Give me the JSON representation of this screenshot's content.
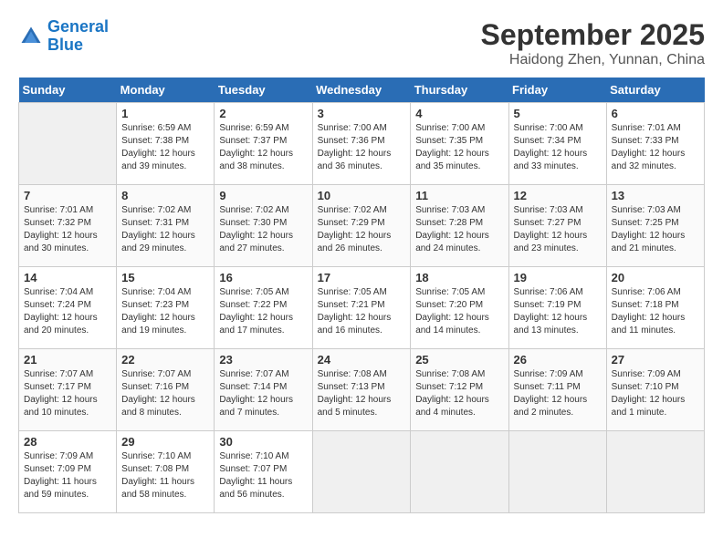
{
  "logo": {
    "line1": "General",
    "line2": "Blue"
  },
  "title": "September 2025",
  "subtitle": "Haidong Zhen, Yunnan, China",
  "weekdays": [
    "Sunday",
    "Monday",
    "Tuesday",
    "Wednesday",
    "Thursday",
    "Friday",
    "Saturday"
  ],
  "weeks": [
    [
      {
        "day": "",
        "empty": true
      },
      {
        "day": "1",
        "sunrise": "Sunrise: 6:59 AM",
        "sunset": "Sunset: 7:38 PM",
        "daylight": "Daylight: 12 hours and 39 minutes."
      },
      {
        "day": "2",
        "sunrise": "Sunrise: 6:59 AM",
        "sunset": "Sunset: 7:37 PM",
        "daylight": "Daylight: 12 hours and 38 minutes."
      },
      {
        "day": "3",
        "sunrise": "Sunrise: 7:00 AM",
        "sunset": "Sunset: 7:36 PM",
        "daylight": "Daylight: 12 hours and 36 minutes."
      },
      {
        "day": "4",
        "sunrise": "Sunrise: 7:00 AM",
        "sunset": "Sunset: 7:35 PM",
        "daylight": "Daylight: 12 hours and 35 minutes."
      },
      {
        "day": "5",
        "sunrise": "Sunrise: 7:00 AM",
        "sunset": "Sunset: 7:34 PM",
        "daylight": "Daylight: 12 hours and 33 minutes."
      },
      {
        "day": "6",
        "sunrise": "Sunrise: 7:01 AM",
        "sunset": "Sunset: 7:33 PM",
        "daylight": "Daylight: 12 hours and 32 minutes."
      }
    ],
    [
      {
        "day": "7",
        "sunrise": "Sunrise: 7:01 AM",
        "sunset": "Sunset: 7:32 PM",
        "daylight": "Daylight: 12 hours and 30 minutes."
      },
      {
        "day": "8",
        "sunrise": "Sunrise: 7:02 AM",
        "sunset": "Sunset: 7:31 PM",
        "daylight": "Daylight: 12 hours and 29 minutes."
      },
      {
        "day": "9",
        "sunrise": "Sunrise: 7:02 AM",
        "sunset": "Sunset: 7:30 PM",
        "daylight": "Daylight: 12 hours and 27 minutes."
      },
      {
        "day": "10",
        "sunrise": "Sunrise: 7:02 AM",
        "sunset": "Sunset: 7:29 PM",
        "daylight": "Daylight: 12 hours and 26 minutes."
      },
      {
        "day": "11",
        "sunrise": "Sunrise: 7:03 AM",
        "sunset": "Sunset: 7:28 PM",
        "daylight": "Daylight: 12 hours and 24 minutes."
      },
      {
        "day": "12",
        "sunrise": "Sunrise: 7:03 AM",
        "sunset": "Sunset: 7:27 PM",
        "daylight": "Daylight: 12 hours and 23 minutes."
      },
      {
        "day": "13",
        "sunrise": "Sunrise: 7:03 AM",
        "sunset": "Sunset: 7:25 PM",
        "daylight": "Daylight: 12 hours and 21 minutes."
      }
    ],
    [
      {
        "day": "14",
        "sunrise": "Sunrise: 7:04 AM",
        "sunset": "Sunset: 7:24 PM",
        "daylight": "Daylight: 12 hours and 20 minutes."
      },
      {
        "day": "15",
        "sunrise": "Sunrise: 7:04 AM",
        "sunset": "Sunset: 7:23 PM",
        "daylight": "Daylight: 12 hours and 19 minutes."
      },
      {
        "day": "16",
        "sunrise": "Sunrise: 7:05 AM",
        "sunset": "Sunset: 7:22 PM",
        "daylight": "Daylight: 12 hours and 17 minutes."
      },
      {
        "day": "17",
        "sunrise": "Sunrise: 7:05 AM",
        "sunset": "Sunset: 7:21 PM",
        "daylight": "Daylight: 12 hours and 16 minutes."
      },
      {
        "day": "18",
        "sunrise": "Sunrise: 7:05 AM",
        "sunset": "Sunset: 7:20 PM",
        "daylight": "Daylight: 12 hours and 14 minutes."
      },
      {
        "day": "19",
        "sunrise": "Sunrise: 7:06 AM",
        "sunset": "Sunset: 7:19 PM",
        "daylight": "Daylight: 12 hours and 13 minutes."
      },
      {
        "day": "20",
        "sunrise": "Sunrise: 7:06 AM",
        "sunset": "Sunset: 7:18 PM",
        "daylight": "Daylight: 12 hours and 11 minutes."
      }
    ],
    [
      {
        "day": "21",
        "sunrise": "Sunrise: 7:07 AM",
        "sunset": "Sunset: 7:17 PM",
        "daylight": "Daylight: 12 hours and 10 minutes."
      },
      {
        "day": "22",
        "sunrise": "Sunrise: 7:07 AM",
        "sunset": "Sunset: 7:16 PM",
        "daylight": "Daylight: 12 hours and 8 minutes."
      },
      {
        "day": "23",
        "sunrise": "Sunrise: 7:07 AM",
        "sunset": "Sunset: 7:14 PM",
        "daylight": "Daylight: 12 hours and 7 minutes."
      },
      {
        "day": "24",
        "sunrise": "Sunrise: 7:08 AM",
        "sunset": "Sunset: 7:13 PM",
        "daylight": "Daylight: 12 hours and 5 minutes."
      },
      {
        "day": "25",
        "sunrise": "Sunrise: 7:08 AM",
        "sunset": "Sunset: 7:12 PM",
        "daylight": "Daylight: 12 hours and 4 minutes."
      },
      {
        "day": "26",
        "sunrise": "Sunrise: 7:09 AM",
        "sunset": "Sunset: 7:11 PM",
        "daylight": "Daylight: 12 hours and 2 minutes."
      },
      {
        "day": "27",
        "sunrise": "Sunrise: 7:09 AM",
        "sunset": "Sunset: 7:10 PM",
        "daylight": "Daylight: 12 hours and 1 minute."
      }
    ],
    [
      {
        "day": "28",
        "sunrise": "Sunrise: 7:09 AM",
        "sunset": "Sunset: 7:09 PM",
        "daylight": "Daylight: 11 hours and 59 minutes."
      },
      {
        "day": "29",
        "sunrise": "Sunrise: 7:10 AM",
        "sunset": "Sunset: 7:08 PM",
        "daylight": "Daylight: 11 hours and 58 minutes."
      },
      {
        "day": "30",
        "sunrise": "Sunrise: 7:10 AM",
        "sunset": "Sunset: 7:07 PM",
        "daylight": "Daylight: 11 hours and 56 minutes."
      },
      {
        "day": "",
        "empty": true
      },
      {
        "day": "",
        "empty": true
      },
      {
        "day": "",
        "empty": true
      },
      {
        "day": "",
        "empty": true
      }
    ]
  ]
}
